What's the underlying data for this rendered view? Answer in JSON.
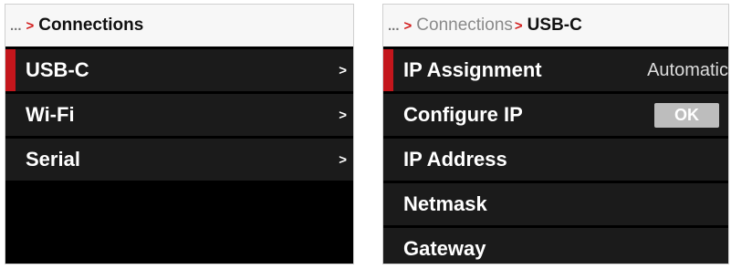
{
  "left_panel": {
    "breadcrumb": {
      "ellipsis": "...",
      "separator": ">",
      "current": "Connections"
    },
    "items": [
      {
        "label": "USB-C",
        "chevron": ">",
        "selected": true
      },
      {
        "label": "Wi-Fi",
        "chevron": ">"
      },
      {
        "label": "Serial",
        "chevron": ">"
      }
    ]
  },
  "right_panel": {
    "breadcrumb": {
      "ellipsis": "...",
      "separator": ">",
      "parent": "Connections",
      "current": "USB-C"
    },
    "items": [
      {
        "label": "IP Assignment",
        "value": "Automatic",
        "selected": true
      },
      {
        "label": "Configure IP",
        "button": "OK"
      },
      {
        "label": "IP Address"
      },
      {
        "label": "Netmask"
      },
      {
        "label": "Gateway"
      }
    ]
  },
  "colors": {
    "accent": "#c4161c",
    "row_background": "#1b1b1b",
    "screen_background": "#000000",
    "breadcrumb_background": "#f7f7f7"
  }
}
